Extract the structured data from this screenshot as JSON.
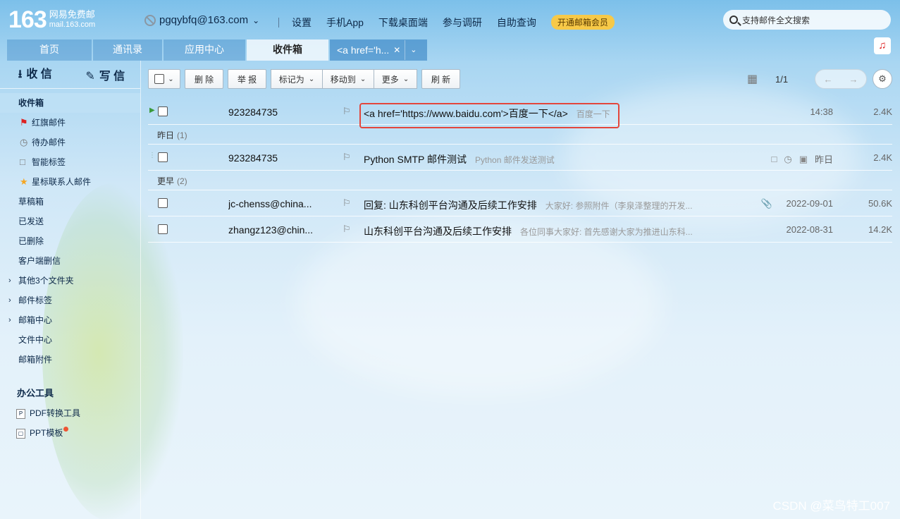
{
  "header": {
    "logo_num": "163",
    "logo_line1": "网易免费邮",
    "logo_line2": "mail.163.com",
    "account": "pgqybfq@163.com",
    "nav": [
      "设置",
      "手机App",
      "下载桌面端",
      "参与调研",
      "自助查询"
    ],
    "vip_label": "开通邮箱会员",
    "search_placeholder": "支持邮件全文搜索"
  },
  "tabs": [
    {
      "label": "首页"
    },
    {
      "label": "通讯录"
    },
    {
      "label": "应用中心"
    },
    {
      "label": "收件箱",
      "active": true
    },
    {
      "label": "<a href='h..."
    }
  ],
  "sidebar": {
    "receive": "收 信",
    "write": "写 信",
    "items": [
      {
        "label": "收件箱",
        "active": true
      },
      {
        "label": "红旗邮件",
        "icon": "red-flag-icon"
      },
      {
        "label": "待办邮件",
        "icon": "clock-icon"
      },
      {
        "label": "智能标签",
        "icon": "tag-icon"
      },
      {
        "label": "星标联系人邮件",
        "icon": "star-icon"
      },
      {
        "label": "草稿箱"
      },
      {
        "label": "已发送"
      },
      {
        "label": "已删除"
      },
      {
        "label": "客户端删信"
      },
      {
        "label": "其他3个文件夹",
        "expandable": true
      },
      {
        "label": "邮件标签",
        "expandable": true
      },
      {
        "label": "邮箱中心",
        "expandable": true
      },
      {
        "label": "文件中心"
      },
      {
        "label": "邮箱附件"
      }
    ],
    "tools_heading": "办公工具",
    "tools": [
      {
        "label": "PDF转换工具"
      },
      {
        "label": "PPT模板"
      }
    ]
  },
  "toolbar": {
    "delete": "删 除",
    "report": "举 报",
    "mark_as": "标记为",
    "move_to": "移动到",
    "more": "更多",
    "refresh": "刷 新",
    "page": "1/1"
  },
  "mail_groups": [
    {
      "title": "",
      "count": "",
      "mails": [
        {
          "from": "923284735",
          "subject": "<a href='https://www.baidu.com'>百度一下</a>",
          "preview": "百度一下",
          "date": "14:38",
          "size": "2.4K",
          "highlighted": true
        }
      ]
    },
    {
      "title": "昨日",
      "count": "(1)",
      "mails": [
        {
          "from": "923284735",
          "subject": "Python SMTP 邮件测试",
          "preview": "Python 邮件发送测试",
          "date": "昨日",
          "size": "2.4K"
        }
      ]
    },
    {
      "title": "更早",
      "count": "(2)",
      "mails": [
        {
          "from": "jc-chenss@china...",
          "subject": "回复: 山东科创平台沟通及后续工作安排",
          "preview": "大家好:    参照附件（李泉泽整理的开发...",
          "date": "2022-09-01",
          "size": "50.6K",
          "attachment": true
        },
        {
          "from": "zhangz123@chin...",
          "subject": "山东科创平台沟通及后续工作安排",
          "preview": "各位同事大家好:    首先感谢大家为推进山东科...",
          "date": "2022-08-31",
          "size": "14.2K"
        }
      ]
    }
  ],
  "watermark": "CSDN @菜鸟特工007"
}
